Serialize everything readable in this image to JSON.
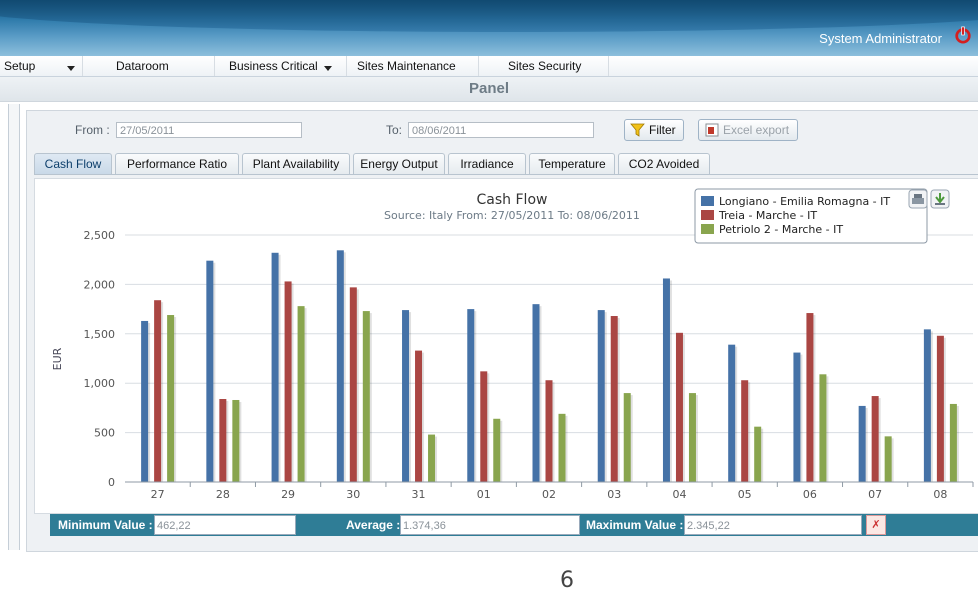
{
  "header": {
    "user_label": "System Administrator",
    "power_icon": "power-icon"
  },
  "menu": [
    {
      "label": "Setup",
      "dropdown": true
    },
    {
      "label": "Dataroom",
      "dropdown": false
    },
    {
      "label": "Business Critical",
      "dropdown": true
    },
    {
      "label": "Sites Maintenance",
      "dropdown": false
    },
    {
      "label": "Sites Security",
      "dropdown": false
    }
  ],
  "panel": {
    "title": "Panel"
  },
  "filters": {
    "from_label": "From :",
    "from_value": "27/05/2011",
    "to_label": "To:",
    "to_value": "08/06/2011",
    "filter_button": "Filter",
    "export_button": "Excel export"
  },
  "tabs": [
    "Cash Flow",
    "Performance Ratio",
    "Plant Availability",
    "Energy Output",
    "Irradiance",
    "Temperature",
    "CO2 Avoided"
  ],
  "active_tab": "Cash Flow",
  "chart_data": {
    "type": "bar",
    "title": "Cash Flow",
    "subtitle": "Source: Italy From: 27/05/2011 To: 08/06/2011",
    "ylabel": "EUR",
    "xlabel": "",
    "ylim": [
      0,
      2500
    ],
    "yticks": [
      0,
      500,
      1000,
      1500,
      2000,
      2500
    ],
    "ytick_labels": [
      "0",
      "500",
      "1,000",
      "1,500",
      "2,000",
      "2,500"
    ],
    "grid": true,
    "legend_position": "top-right",
    "categories": [
      "27",
      "28",
      "29",
      "30",
      "31",
      "01",
      "02",
      "03",
      "04",
      "05",
      "06",
      "07",
      "08"
    ],
    "series": [
      {
        "name": "Longiano - Emilia Romagna - IT",
        "color": "#4572A7",
        "values": [
          1630,
          2240,
          2320,
          2345,
          1740,
          1750,
          1800,
          1740,
          2060,
          1390,
          1310,
          770,
          1545
        ]
      },
      {
        "name": "Treia - Marche - IT",
        "color": "#AA4643",
        "values": [
          1840,
          840,
          2030,
          1970,
          1330,
          1120,
          1030,
          1680,
          1510,
          1030,
          1710,
          870,
          1480
        ]
      },
      {
        "name": "Petriolo 2 - Marche - IT",
        "color": "#89A54E",
        "values": [
          1690,
          830,
          1780,
          1730,
          480,
          640,
          690,
          900,
          900,
          560,
          1090,
          462,
          790
        ]
      }
    ]
  },
  "stats": {
    "min_label": "Minimum Value :",
    "min_value": "462,22",
    "avg_label": "Average :",
    "avg_value": "1.374,36",
    "max_label": "Maximum Value :",
    "max_value": "2.345,22"
  },
  "page_number": "6"
}
